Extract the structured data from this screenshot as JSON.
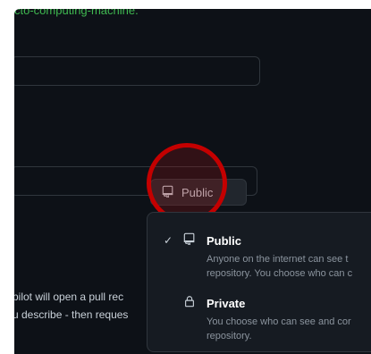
{
  "header": {
    "text": "cto-computing-machine."
  },
  "visibility": {
    "button_label": "Public",
    "icon": "repo-icon"
  },
  "description": {
    "line1": "pilot will open a pull rec",
    "line2": "u describe - then reques"
  },
  "menu": {
    "public": {
      "title": "Public",
      "desc_line1": "Anyone on the internet can see t",
      "desc_line2": "repository. You choose who can c",
      "checked": true,
      "icon": "repo-icon"
    },
    "private": {
      "title": "Private",
      "desc_line1": "You choose who can see and cor",
      "desc_line2": "repository.",
      "icon": "lock-icon"
    }
  },
  "colors": {
    "background": "#0d1117",
    "accent_green": "#3fb950",
    "highlight_red": "#c40000"
  }
}
